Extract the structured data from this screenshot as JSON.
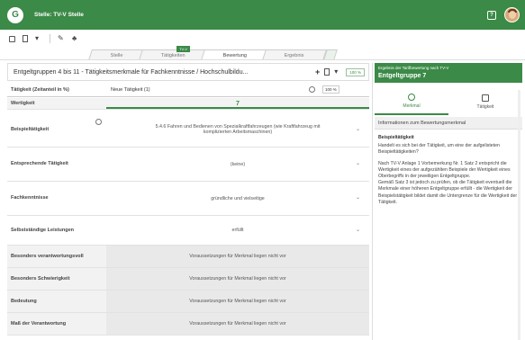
{
  "app": {
    "title": "Stelle: TV-V Stelle",
    "logo": "G",
    "help": "?"
  },
  "toolbar": {
    "icons": [
      "save-icon",
      "document-icon",
      "tools-icon",
      "org-icon"
    ]
  },
  "tabs": [
    {
      "label": "Stelle",
      "active": false
    },
    {
      "label": "Tätigkeiten",
      "active": false
    },
    {
      "label": "Bewertung",
      "active": true,
      "badge": "TV-V"
    },
    {
      "label": "Ergebnis",
      "active": false
    }
  ],
  "header": {
    "title": "Entgeltgruppen 4 bis 11 - Tätigkeitsmerkmale für Fachkenntnisse / Hochschulbildu...",
    "percent": "100 %"
  },
  "table": {
    "first_row": {
      "label": "Tätigkeit (Zeitanteil in %)",
      "value": "Neue Tätigkeit (1)",
      "percent": "100 %"
    },
    "wertigkeit": {
      "label": "Wertigkeit",
      "value": "7"
    },
    "rows": [
      {
        "label": "Beispieltätigkeit",
        "value": "5.4.6 Fahren und Bedienen von Spezialkraftfahrzeugen (wie Kraftfahrzeug mit komplizierten Arbeitsmaschinen)",
        "grey": false
      },
      {
        "label": "Entsprechende Tätigkeit",
        "value": "(keine)",
        "grey": false
      },
      {
        "label": "Fachkenntnisse",
        "value": "gründliche und vielseitige",
        "grey": false
      },
      {
        "label": "Selbstständige Leistungen",
        "value": "erfüllt",
        "grey": false
      },
      {
        "label": "Besonders verantwortungsvoll",
        "value": "Voraussetzungen für Merkmal liegen nicht vor",
        "grey": true
      },
      {
        "label": "Besonders Schwierigkeit",
        "value": "Voraussetzungen für Merkmal liegen nicht vor",
        "grey": true
      },
      {
        "label": "Bedeutung",
        "value": "Voraussetzungen für Merkmal liegen nicht vor",
        "grey": true
      },
      {
        "label": "Maß der Verantwortung",
        "value": "Voraussetzungen für Merkmal liegen nicht vor",
        "grey": true
      }
    ]
  },
  "sidebar": {
    "result_label": "Ergebnis der Tarifbewertung nach TV-V",
    "result_value": "Entgeltgruppe 7",
    "tabs": [
      {
        "label": "Merkmal",
        "icon": "info-icon",
        "active": true
      },
      {
        "label": "Tätigkeit",
        "icon": "document-icon",
        "active": false
      }
    ],
    "info_title": "Informationen zum Bewertungsmerkmal",
    "heading": "Beispieltätigkeit",
    "paragraphs": [
      "Handelt es sich bei der Tätigkeit, um eine der aufgelisteten Beispieltätigkeiten?",
      "Nach TV-V Anlage 1 Vorbemerkung Nr. 1 Satz 2 entspricht die Wertigkeit eines der aufgezählten Beispiele der Wertigkeit eines Oberbegriffs in der jeweiligen Entgeltgruppe.",
      "Gemäß Satz 3 ist jedoch zu prüfen, ob die Tätigkeit eventuell die Merkmale einer höheren Entgeltgruppe erfüllt - die Wertigkeit der Beispielstätigkeit bildet damit die Untergrenze für die Wertigkeit der Tätigkeit."
    ]
  },
  "colors": {
    "accent": "#3b8a47",
    "header_bg": "#3b8a47"
  }
}
